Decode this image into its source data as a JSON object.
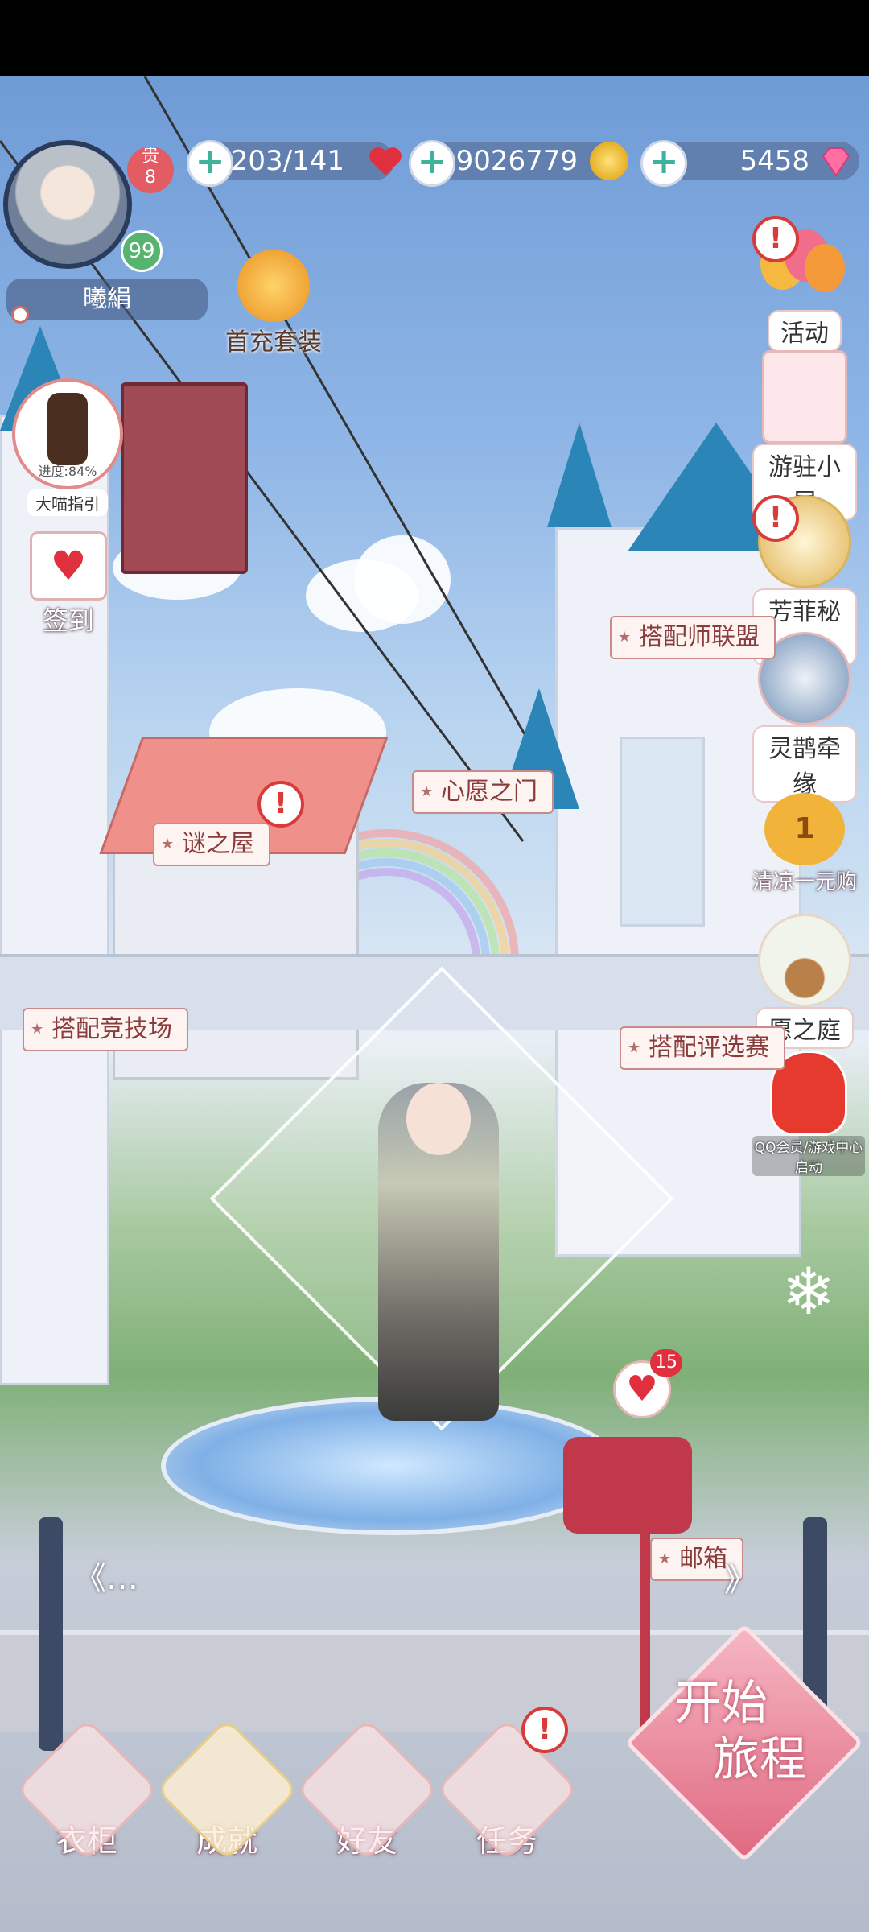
{
  "status_bar": {
    "stamina": "203/141",
    "gold": "9026779",
    "diamonds": "5458"
  },
  "profile": {
    "vip_label": "贵",
    "vip_level": "8",
    "level": "99",
    "name": "曦絹"
  },
  "left_menu": {
    "first_recharge": "首充套装",
    "guide_progress": "进度:84%",
    "guide_label": "大喵指引",
    "checkin": "签到"
  },
  "right_menu": {
    "activity": "活动",
    "cottage": "游驻小屋",
    "secret_realm": "芳菲秘境",
    "magpie": "灵鹊牵缘",
    "one_yuan": "清凉一元购",
    "one_yuan_badge": "1",
    "wish_garden": "愿之庭",
    "qq_vip": "QQ会员/游戏中心启动"
  },
  "scene_signs": {
    "stylist_league": "搭配师联盟",
    "wish_gate": "心愿之门",
    "mystery_house": "谜之屋",
    "arena": "搭配竞技场",
    "selection": "搭配评选赛",
    "mailbox": "邮箱",
    "mail_count": "15"
  },
  "bottom_nav": {
    "wardrobe": "衣柜",
    "achievement": "成就",
    "friends": "好友",
    "tasks": "任务",
    "start_line1": "开始",
    "start_line2": "旅程"
  },
  "icons": {
    "alert": "!",
    "plus": "+",
    "prev": "《…",
    "next": "》"
  },
  "colors": {
    "accent": "#d93b3b",
    "pill_bg": "#5a6e94",
    "roof": "#2b86b7"
  }
}
